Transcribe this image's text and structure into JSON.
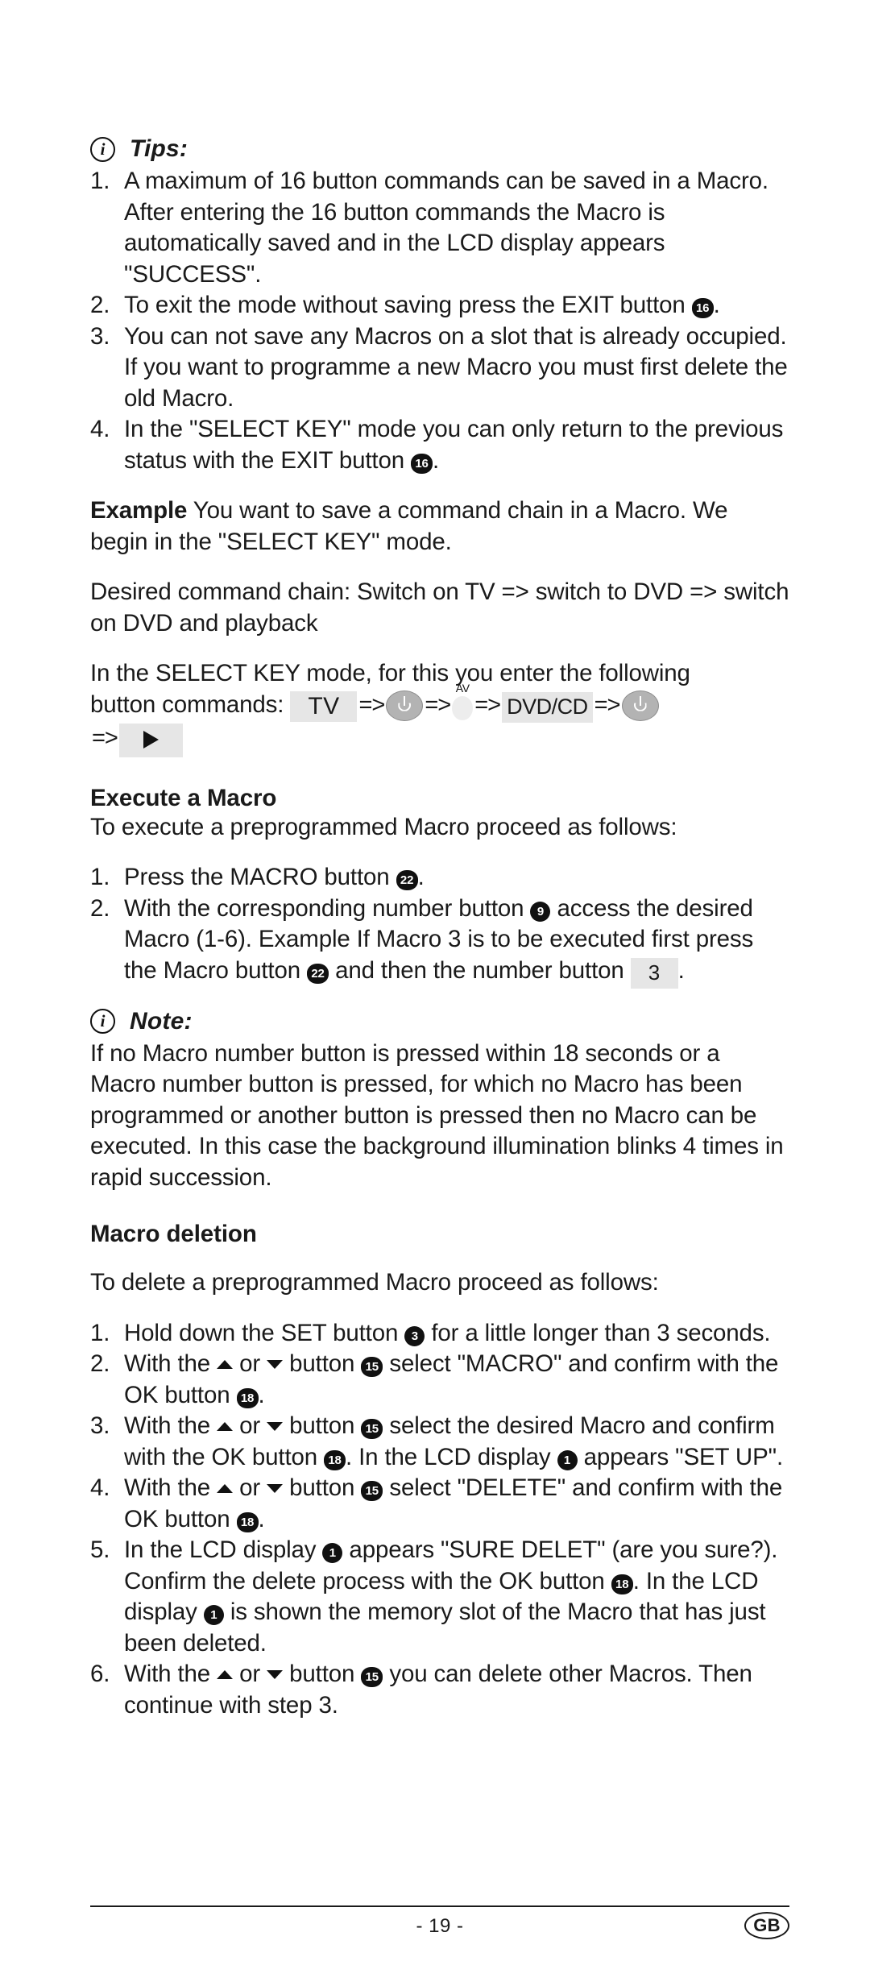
{
  "document": {
    "language_badge": "GB",
    "page_number": "- 19 -"
  },
  "tips": {
    "icon": "info-icon",
    "title": "Tips:",
    "items": [
      {
        "number": "1.",
        "text_before": "A maximum of 16 button commands can be saved in a Macro. After entering the 16 button commands the Macro is automatically saved and in the LCD display appears \"SUCCESS\"."
      },
      {
        "number": "2.",
        "text_before": "To exit the mode without saving press the EXIT button ",
        "badge": "16",
        "text_after": "."
      },
      {
        "number": "3.",
        "text_before": "You can not save any Macros on a slot that is already occupied. If you want to programme a new Macro you must first delete the old Macro."
      },
      {
        "number": "4.",
        "text_before": "In the \"SELECT KEY\" mode you can only return to the previous status with the EXIT button ",
        "badge": "16",
        "text_after": "."
      }
    ]
  },
  "example": {
    "lead_bold": "Example",
    "lead_rest": " You want to save a command chain in a Macro. We begin in the \"SELECT KEY\" mode.",
    "desired_chain": "Desired command chain: Switch on TV => switch to DVD => switch on DVD and playback",
    "instruction_line1": "In the SELECT KEY mode, for this you enter the following",
    "instruction_line2_prefix": "button commands:",
    "sequence": [
      {
        "type": "chip",
        "label": "TV"
      },
      {
        "type": "arrow",
        "label": "=>"
      },
      {
        "type": "power",
        "label": "power-button"
      },
      {
        "type": "arrow",
        "label": "=>"
      },
      {
        "type": "av",
        "label": "AV"
      },
      {
        "type": "arrow",
        "label": "=>"
      },
      {
        "type": "chip",
        "label": "DVD/CD"
      },
      {
        "type": "arrow",
        "label": "=>"
      },
      {
        "type": "power",
        "label": "power-button"
      },
      {
        "type": "arrow",
        "label": "=>"
      },
      {
        "type": "play",
        "label": "play-button"
      }
    ]
  },
  "execute_macro": {
    "heading": "Execute a Macro",
    "intro": "To execute a preprogrammed Macro proceed as follows:",
    "items": [
      {
        "number": "1.",
        "text_before": "Press the MACRO button ",
        "badge": "22",
        "text_after": "."
      },
      {
        "number": "2.",
        "text_before": "With the corresponding number button ",
        "badge": "9",
        "text_mid": " access the desired Macro (1-6). Example If Macro 3 is to be executed first press the Macro button ",
        "badge2": "22",
        "text_mid2": " and then the number button ",
        "chip": "3",
        "text_after": "."
      }
    ]
  },
  "note": {
    "icon": "info-icon",
    "title": "Note:",
    "body": "If no Macro number button is pressed within 18 seconds or a Macro number button is pressed, for which no Macro has been programmed or another button is pressed then no Macro can be executed. In this case the background illumination blinks 4 times in rapid succession."
  },
  "macro_deletion": {
    "heading": "Macro deletion",
    "intro": "To delete a preprogrammed Macro proceed as follows:",
    "items": [
      {
        "number": "1.",
        "text_before": "Hold down the SET button ",
        "badge": "3",
        "text_after": " for a little longer than 3 seconds."
      },
      {
        "number": "2.",
        "text_before": "With the ",
        "arrow_up": "▲",
        "text_or": " or ",
        "arrow_down": "▼",
        "text_mid": " button ",
        "badge": "15",
        "text_mid2": " select \"MACRO\" and confirm with the OK button ",
        "badge2": "18",
        "text_after": "."
      },
      {
        "number": "3.",
        "text_before": "With the ",
        "arrow_up": "▲",
        "text_or": " or ",
        "arrow_down": "▼",
        "text_mid": " button ",
        "badge": "15",
        "text_mid2": " select the desired Macro and confirm with the OK button ",
        "badge2": "18",
        "text_mid3": ". In the LCD display ",
        "badge3": "1",
        "text_after": " appears \"SET UP\"."
      },
      {
        "number": "4.",
        "text_before": "With the ",
        "arrow_up": "▲",
        "text_or": " or ",
        "arrow_down": "▼",
        "text_mid": " button ",
        "badge": "15",
        "text_mid2": " select \"DELETE\" and confirm with the OK button ",
        "badge2": "18",
        "text_after": "."
      },
      {
        "number": "5.",
        "text_before": "In the LCD display ",
        "badge": "1",
        "text_mid": " appears \"SURE DELET\" (are you sure?). Confirm the delete process with the OK button ",
        "badge2": "18",
        "text_mid2": ". In the LCD display ",
        "badge3": "1",
        "text_after": " is shown the memory slot of the Macro that has just been deleted."
      },
      {
        "number": "6.",
        "text_before": "With the ",
        "arrow_up": "▲",
        "text_or": " or ",
        "arrow_down": "▼",
        "text_mid": " button ",
        "badge": "15",
        "text_after": " you can delete other Macros. Then continue with step 3."
      }
    ]
  }
}
